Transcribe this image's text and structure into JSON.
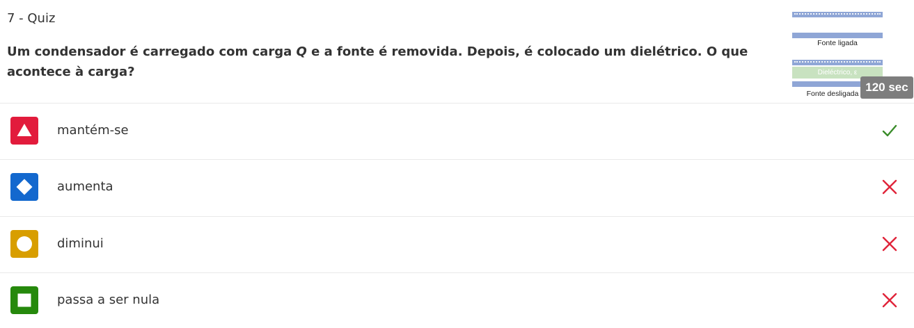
{
  "question": {
    "number_label": "7 - Quiz",
    "text_before": "Um condensador é carregado com carga ",
    "text_var": "Q",
    "text_after": " e a fonte é removida. Depois, é colocado um dielétrico. O que acontece à carga?"
  },
  "thumbnail": {
    "label_top": "Fonte ligada",
    "label_dielectric": "Dieléctrico, ε",
    "label_bottom": "Fonte desligada"
  },
  "timer": {
    "label": "120 sec"
  },
  "options": [
    {
      "text": "mantém-se",
      "shape": "triangle",
      "color": "#e21b3c",
      "correct": true,
      "mark_icon": "check-icon"
    },
    {
      "text": "aumenta",
      "shape": "diamond",
      "color": "#1368ce",
      "correct": false,
      "mark_icon": "cross-icon"
    },
    {
      "text": "diminui",
      "shape": "circle",
      "color": "#d89e00",
      "correct": false,
      "mark_icon": "cross-icon"
    },
    {
      "text": "passa a ser nula",
      "shape": "square",
      "color": "#26890c",
      "correct": false,
      "mark_icon": "cross-icon"
    }
  ],
  "colors": {
    "correct": "#3a8c2a",
    "incorrect": "#e0243a"
  }
}
